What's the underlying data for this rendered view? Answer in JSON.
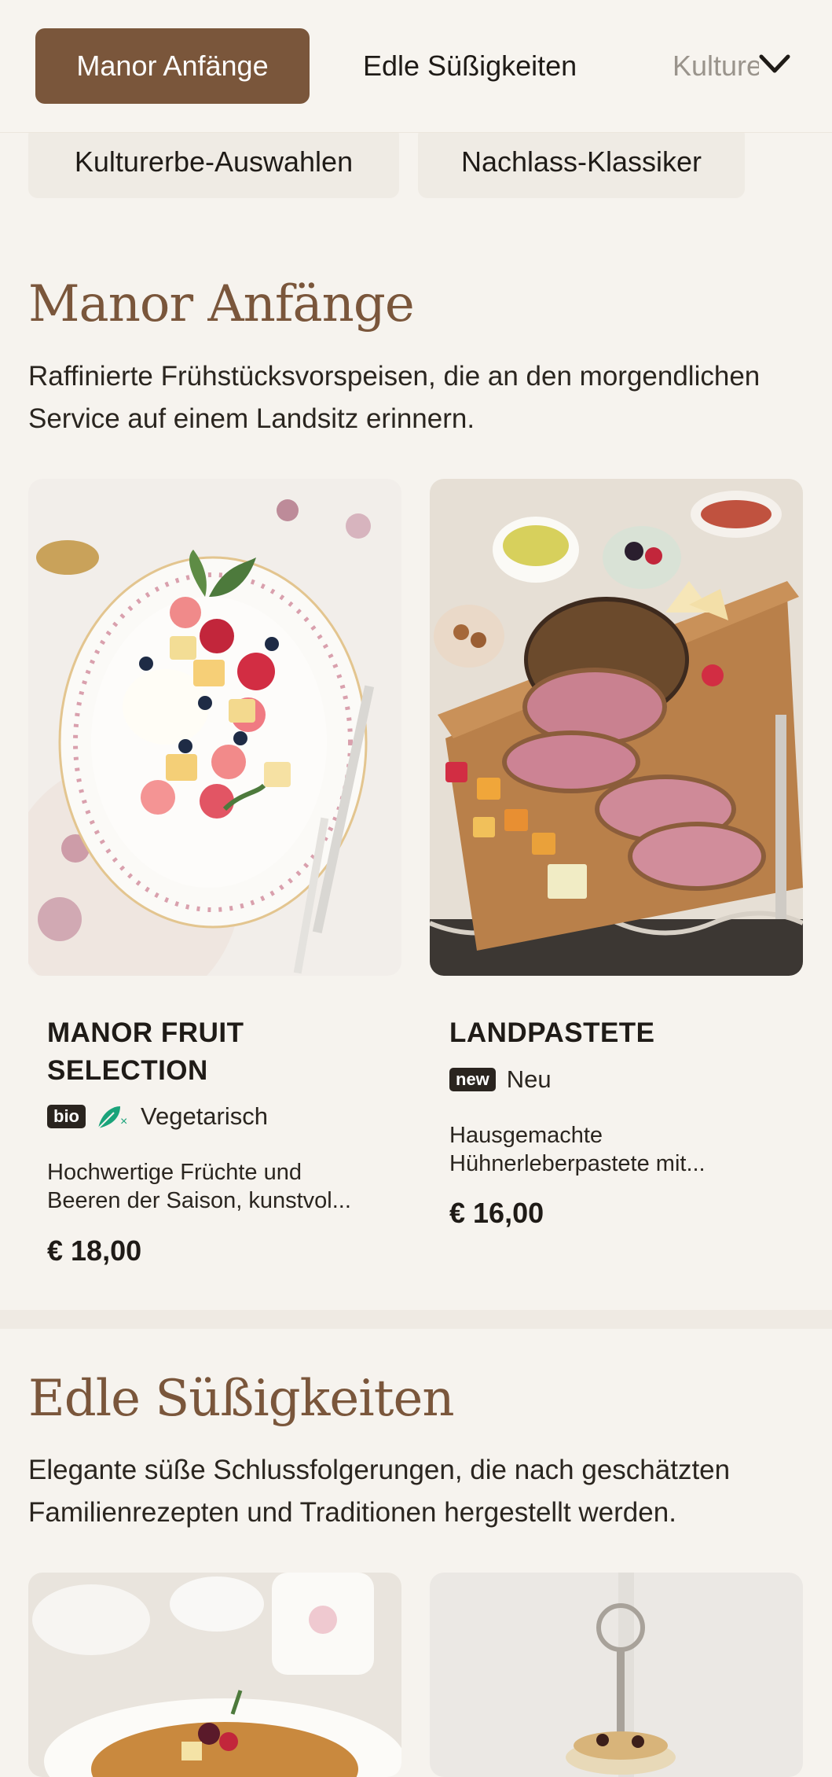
{
  "nav": {
    "tabs": [
      "Manor Anfänge",
      "Edle Süßigkeiten",
      "Kulturerbe"
    ],
    "subtabs": [
      "Kulturerbe-Auswahlen",
      "Nachlass-Klassiker"
    ]
  },
  "sections": [
    {
      "title": "Manor Anfänge",
      "description": "Raffinierte Frühstücksvorspeisen, die an den morgendlichen Service auf einem Landsitz erinnern.",
      "items": [
        {
          "name_line1": "MANOR FRUIT",
          "name_line2": "SELECTION",
          "badge": "bio",
          "tag": "Vegetarisch",
          "description_line1": "Hochwertige Früchte und",
          "description_line2": "Beeren der Saison, kunstvol...",
          "price": "€ 18,00"
        },
        {
          "name": "LANDPASTETE",
          "badge": "new",
          "tag": "Neu",
          "description_line1": "Hausgemachte",
          "description_line2": "Hühnerleberpastete mit...",
          "price": "€ 16,00"
        }
      ]
    },
    {
      "title": "Edle Süßigkeiten",
      "description": "Elegante süße Schlussfolgerungen, die nach geschätzten Familienrezepten und Traditionen hergestellt werden."
    }
  ],
  "colors": {
    "accent": "#7a563b",
    "background": "#f6f3ee",
    "leaf": "#1aa37a"
  }
}
